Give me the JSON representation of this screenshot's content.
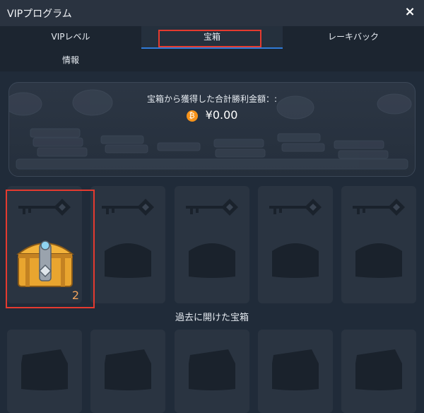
{
  "window": {
    "title": "VIPプログラム",
    "close_symbol": "×"
  },
  "tabs": [
    {
      "label": "VIPレベル"
    },
    {
      "label": "宝箱",
      "active": true
    },
    {
      "label": "レーキバック"
    },
    {
      "label": "情報"
    }
  ],
  "summary": {
    "label": "宝箱から獲得した合計勝利金額：:",
    "currency_icon": "bitcoin-icon",
    "amount": "¥0.00"
  },
  "chests": {
    "available_count": "2",
    "past_title": "過去に開けた宝箱"
  },
  "colors": {
    "accent_tab": "#2f7bd8",
    "highlight": "#e53a2f",
    "chest_gold": "#f3b33a",
    "count_orange": "#f0a35c"
  }
}
